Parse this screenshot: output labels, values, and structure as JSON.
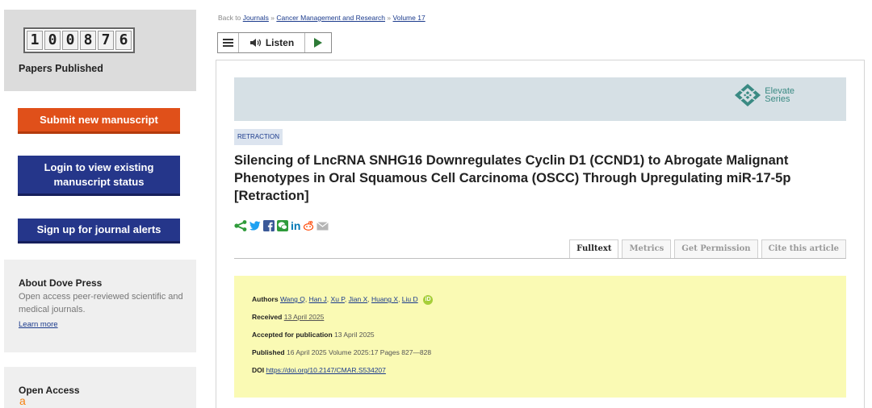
{
  "sidebar": {
    "counter_digits": [
      "1",
      "0",
      "0",
      "8",
      "7",
      "6"
    ],
    "counter_label": "Papers Published",
    "submit_label": "Submit new manuscript",
    "login_label": "Login to view existing manuscript status",
    "alerts_label": "Sign up for journal alerts",
    "about_title": "About Dove Press",
    "about_text": "Open access peer-reviewed scientific and medical journals.",
    "about_link": "Learn more",
    "oa_title": "Open Access"
  },
  "breadcrumb": {
    "prefix": "Back to",
    "items": [
      "Journals",
      "Cancer Management and Research",
      "Volume 17"
    ],
    "separator": "»"
  },
  "player": {
    "listen_label": "Listen"
  },
  "banner": {
    "brand_line1": "Elevate",
    "brand_line2": "Series"
  },
  "article": {
    "tag": "RETRACTION",
    "title": "Silencing of LncRNA SNHG16 Downregulates Cyclin D1 (CCND1) to Abrogate Malignant Phenotypes in Oral Squamous Cell Carcinoma (OSCC) Through Upregulating miR-17-5p [Retraction]"
  },
  "share_icons": [
    "share-icon",
    "twitter-icon",
    "facebook-icon",
    "wechat-icon",
    "linkedin-icon",
    "reddit-icon",
    "email-icon"
  ],
  "tabs": [
    "Fulltext",
    "Metrics",
    "Get Permission",
    "Cite this article"
  ],
  "meta": {
    "authors_label": "Authors",
    "authors": [
      "Wang Q",
      "Han J",
      "Xu P",
      "Jian X",
      "Huang X",
      "Liu D"
    ],
    "received_label": "Received",
    "received": "13 April 2025",
    "accepted_label": "Accepted for publication",
    "accepted": "13 April 2025",
    "published_label": "Published",
    "published": "16 April 2025 Volume 2025:17 Pages 827—828",
    "doi_label": "DOI",
    "doi": "https://doi.org/10.2147/CMAR.S534207"
  },
  "colors": {
    "submit": "#e0501a",
    "navy": "#25368a",
    "banner": "#d6e0e5",
    "meta_bg": "#fafab4",
    "share_green": "#2e9b3a",
    "twitter": "#1da1f2",
    "facebook": "#3b5998",
    "linkedin": "#0077b5"
  }
}
